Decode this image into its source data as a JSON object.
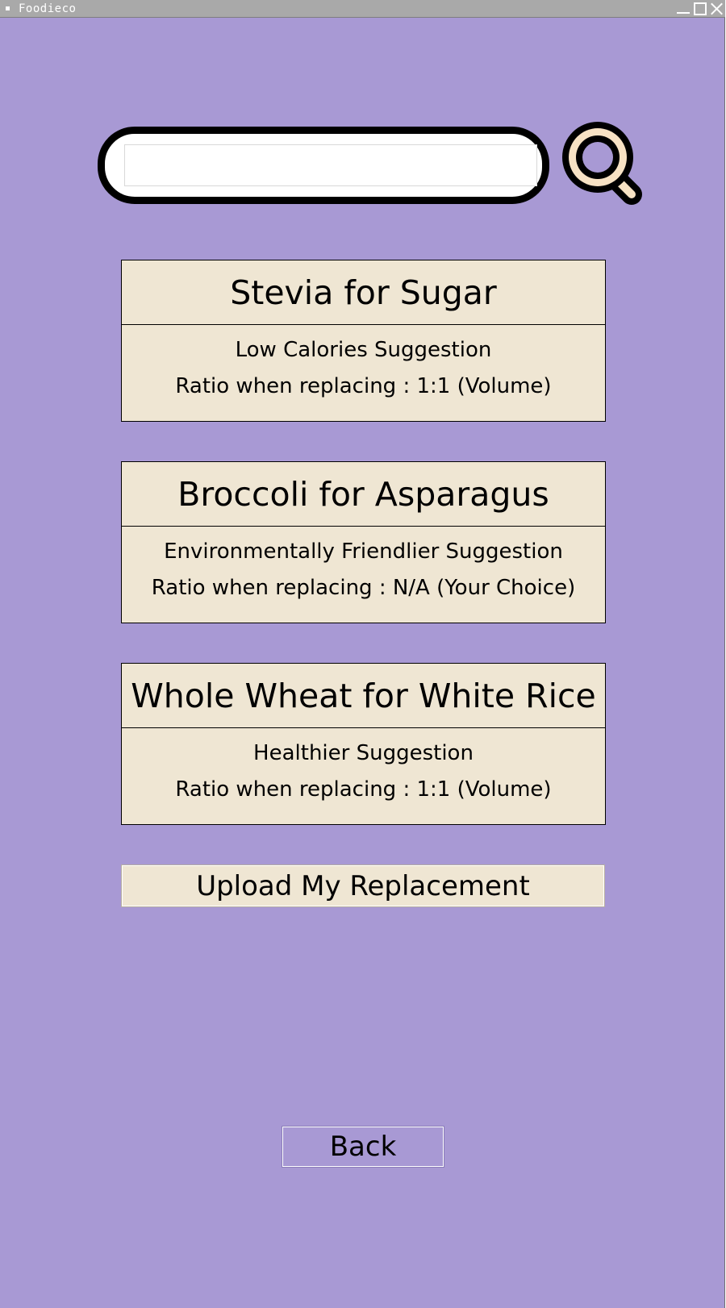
{
  "window": {
    "title": "Foodieco"
  },
  "search": {
    "value": "",
    "placeholder": ""
  },
  "suggestions": [
    {
      "title": "Stevia for Sugar",
      "category": "Low Calories Suggestion",
      "ratio": "Ratio when replacing : 1:1 (Volume)"
    },
    {
      "title": "Broccoli for Asparagus",
      "category": "Environmentally Friendlier Suggestion",
      "ratio": "Ratio when replacing : N/A (Your Choice)"
    },
    {
      "title": "Whole Wheat for White Rice",
      "category": "Healthier Suggestion",
      "ratio": "Ratio when replacing : 1:1 (Volume)"
    }
  ],
  "actions": {
    "upload_label": "Upload My Replacement",
    "back_label": "Back"
  },
  "icons": {
    "search": "search-icon",
    "minimize": "minimize-icon",
    "maximize": "maximize-icon",
    "close": "close-icon"
  },
  "colors": {
    "background": "#a899d4",
    "card": "#efe6d3",
    "search_icon_fill": "#f7e2c4",
    "outline": "#000000"
  }
}
